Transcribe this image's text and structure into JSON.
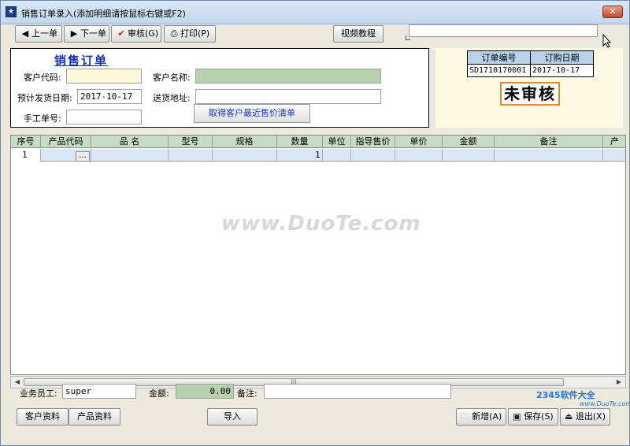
{
  "window": {
    "title": "销售订单录入(添加明细请按鼠标右键或F2)",
    "close_label": "✕"
  },
  "toolbar": {
    "prev": "上一单",
    "next": "下一单",
    "audit": "审核(G)",
    "print": "打印(P)",
    "video": "视频教程"
  },
  "form": {
    "title": "销售订单",
    "customer_code_label": "客户代码:",
    "customer_code": "",
    "customer_name_label": "客户名称:",
    "customer_name": "",
    "ship_date_label": "预计发货日期:",
    "ship_date": "2017-10-17",
    "address_label": "送货地址:",
    "address": "",
    "manual_no_label": "手工单号:",
    "manual_no": "",
    "fetch_button": "取得客户最近售价清单"
  },
  "order_info": {
    "order_no_header": "订单编号",
    "order_date_header": "订购日期",
    "order_no": "SD1710170001",
    "order_date": "2017-10-17",
    "status": "未审核",
    "status_color": "#e48b2a"
  },
  "grid": {
    "columns": [
      "序号",
      "产品代码",
      "品  名",
      "型号",
      "规格",
      "数量",
      "单位",
      "指导售价",
      "单价",
      "金额",
      "备注",
      "产"
    ],
    "rows": [
      [
        "1",
        "",
        "",
        "",
        "",
        "1",
        "",
        "",
        "",
        "",
        "",
        ""
      ]
    ],
    "ellipsis": "..."
  },
  "scrollbar": {
    "grip": "|||"
  },
  "watermark": "www.DuoTe.com",
  "footer": {
    "salesman_label": "业务员工:",
    "salesman": "super",
    "amount_label": "金额:",
    "amount": "0.00",
    "remark_label": "备注:",
    "remark": "",
    "customer_data": "客户资料",
    "product_data": "产品资料",
    "import": "导入",
    "add": "新增(A)",
    "save": "保存(S)",
    "exit": "退出(X)"
  },
  "branding": {
    "logo": "2345软件大全",
    "sub": "www.DuoTe.com"
  }
}
